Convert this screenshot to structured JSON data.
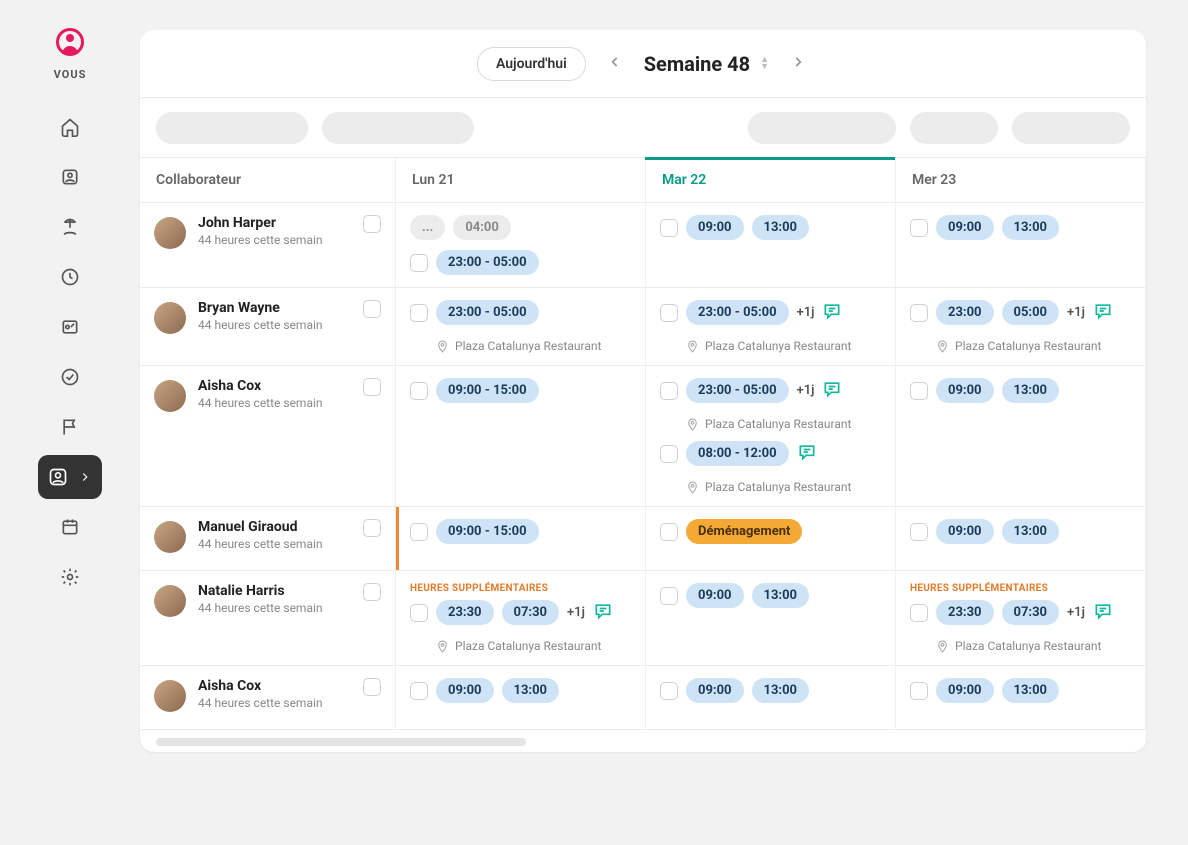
{
  "sidebar": {
    "label": "VOUS"
  },
  "topbar": {
    "today": "Aujourd'hui",
    "week_label": "Semaine 48"
  },
  "headers": {
    "collaborator": "Collaborateur",
    "days": [
      "Lun 21",
      "Mar 22",
      "Mer 23"
    ],
    "current_index": 1
  },
  "overtime_label": "HEURES SUPPLÉMENTAIRES",
  "location": "Plaza Catalunya Restaurant",
  "employees": [
    {
      "name": "John Harper",
      "subtitle": "44 heures cette semain",
      "days": [
        {
          "entries": [
            {
              "kind": "double_dim",
              "a": "...",
              "b": "04:00"
            },
            {
              "kind": "range",
              "text": "23:00 - 05:00"
            }
          ]
        },
        {
          "entries": [
            {
              "kind": "double",
              "a": "09:00",
              "b": "13:00"
            }
          ]
        },
        {
          "entries": [
            {
              "kind": "double",
              "a": "09:00",
              "b": "13:00"
            }
          ]
        }
      ]
    },
    {
      "name": "Bryan Wayne",
      "subtitle": "44 heures cette semain",
      "days": [
        {
          "entries": [
            {
              "kind": "range",
              "text": "23:00 - 05:00",
              "location": true
            }
          ]
        },
        {
          "entries": [
            {
              "kind": "range",
              "text": "23:00 - 05:00",
              "extra": "+1j",
              "comment": true,
              "location": true
            }
          ]
        },
        {
          "entries": [
            {
              "kind": "double",
              "a": "23:00",
              "b": "05:00",
              "extra": "+1j",
              "comment": true,
              "location": true
            }
          ]
        }
      ]
    },
    {
      "name": "Aisha Cox",
      "subtitle": "44 heures cette semain",
      "days": [
        {
          "entries": [
            {
              "kind": "range",
              "text": "09:00 - 15:00"
            }
          ]
        },
        {
          "entries": [
            {
              "kind": "range",
              "text": "23:00 - 05:00",
              "extra": "+1j",
              "comment": true,
              "location": true
            },
            {
              "kind": "range",
              "text": "08:00 - 12:00",
              "comment": true,
              "location": true
            }
          ]
        },
        {
          "entries": [
            {
              "kind": "double",
              "a": "09:00",
              "b": "13:00"
            }
          ]
        }
      ]
    },
    {
      "name": "Manuel Giraoud",
      "subtitle": "44 heures cette semain",
      "days": [
        {
          "left_bar": true,
          "entries": [
            {
              "kind": "range",
              "text": "09:00 - 15:00"
            }
          ]
        },
        {
          "entries": [
            {
              "kind": "tag",
              "text": "Déménagement"
            }
          ]
        },
        {
          "entries": [
            {
              "kind": "double",
              "a": "09:00",
              "b": "13:00"
            }
          ]
        }
      ]
    },
    {
      "name": "Natalie Harris",
      "subtitle": "44 heures cette semain",
      "days": [
        {
          "overtime": true,
          "entries": [
            {
              "kind": "double",
              "a": "23:30",
              "b": "07:30",
              "extra": "+1j",
              "comment": true,
              "location": true
            }
          ]
        },
        {
          "entries": [
            {
              "kind": "double",
              "a": "09:00",
              "b": "13:00"
            }
          ]
        },
        {
          "overtime": true,
          "entries": [
            {
              "kind": "double",
              "a": "23:30",
              "b": "07:30",
              "extra": "+1j",
              "comment": true,
              "location": true
            }
          ]
        }
      ]
    },
    {
      "name": "Aisha Cox",
      "subtitle": "44 heures cette semain",
      "days": [
        {
          "entries": [
            {
              "kind": "double",
              "a": "09:00",
              "b": "13:00"
            }
          ]
        },
        {
          "entries": [
            {
              "kind": "double",
              "a": "09:00",
              "b": "13:00"
            }
          ]
        },
        {
          "entries": [
            {
              "kind": "double",
              "a": "09:00",
              "b": "13:00"
            }
          ]
        }
      ]
    }
  ]
}
